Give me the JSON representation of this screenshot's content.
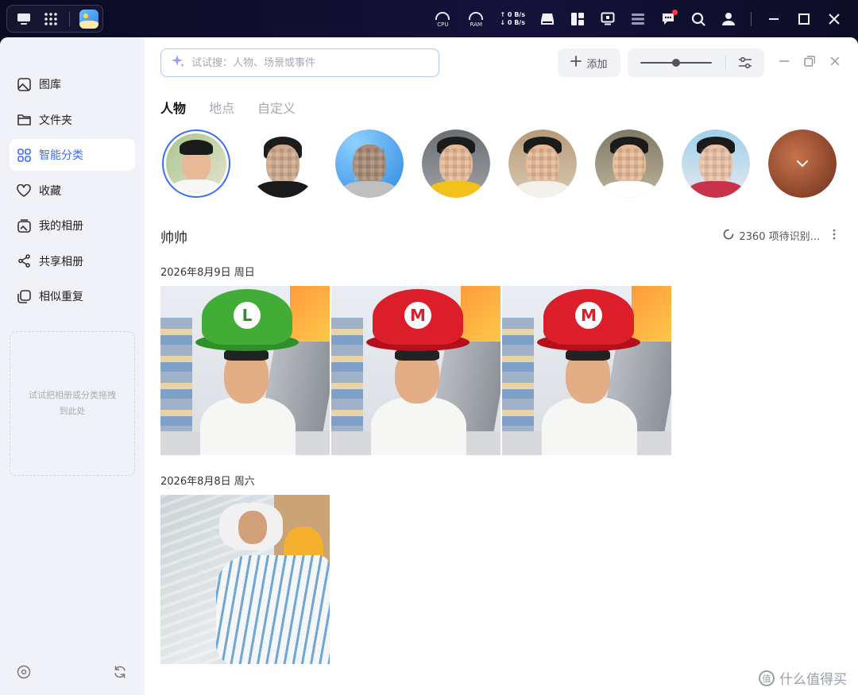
{
  "sysbar": {
    "cpu_label": "CPU",
    "ram_label": "RAM",
    "up_rate": "0 B/s",
    "down_rate": "0 B/s"
  },
  "sidebar": {
    "items": [
      {
        "label": "图库",
        "icon": "gallery-icon",
        "active": false
      },
      {
        "label": "文件夹",
        "icon": "folder-icon",
        "active": false
      },
      {
        "label": "智能分类",
        "icon": "grid-icon",
        "active": true
      },
      {
        "label": "收藏",
        "icon": "heart-icon",
        "active": false
      },
      {
        "label": "我的相册",
        "icon": "album-icon",
        "active": false
      },
      {
        "label": "共享相册",
        "icon": "share-icon",
        "active": false
      },
      {
        "label": "相似重复",
        "icon": "duplicate-icon",
        "active": false
      }
    ],
    "dropzone_text": "试试把相册或分类拖拽到此处"
  },
  "toolbar": {
    "search_placeholder": "试试搜：人物、场景或事件",
    "add_label": "添加",
    "zoom_level": 0.5
  },
  "tabs": [
    {
      "label": "人物",
      "active": true
    },
    {
      "label": "地点",
      "active": false
    },
    {
      "label": "自定义",
      "active": false
    }
  ],
  "person": {
    "name": "帅帅",
    "pending_text": "2360 项待识别..."
  },
  "groups": [
    {
      "date": "2026年8月9日 周日"
    },
    {
      "date": "2026年8月8日 周六"
    }
  ],
  "watermark": {
    "text": "什么值得买",
    "badge": "值"
  },
  "colors": {
    "accent": "#3a6ff0",
    "sidebar_bg": "#f1f2f7",
    "notification": "#ff3b3b"
  }
}
